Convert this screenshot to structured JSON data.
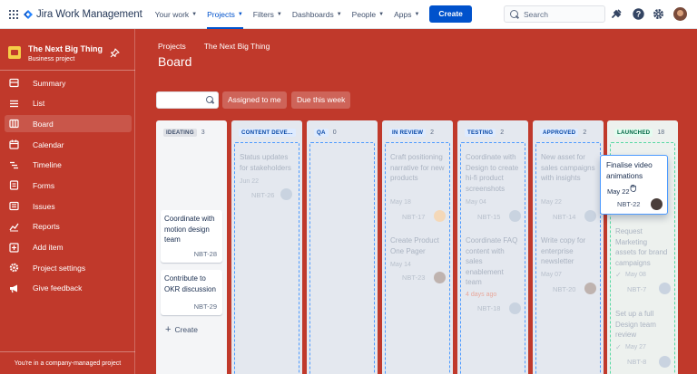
{
  "topnav": {
    "brand": "Jira Work Management",
    "menu": [
      {
        "label": "Your work"
      },
      {
        "label": "Projects"
      },
      {
        "label": "Filters"
      },
      {
        "label": "Dashboards"
      },
      {
        "label": "People"
      },
      {
        "label": "Apps"
      }
    ],
    "active_menu": "Projects",
    "create_label": "Create",
    "search_placeholder": "Search",
    "colors": {
      "accent": "#0052cc"
    }
  },
  "sidebar": {
    "project_name": "The Next Big Thing",
    "project_type": "Business project",
    "items": [
      {
        "label": "Summary",
        "icon": "summary-icon"
      },
      {
        "label": "List",
        "icon": "list-icon"
      },
      {
        "label": "Board",
        "icon": "board-icon",
        "active": true
      },
      {
        "label": "Calendar",
        "icon": "calendar-icon"
      },
      {
        "label": "Timeline",
        "icon": "timeline-icon"
      },
      {
        "label": "Forms",
        "icon": "forms-icon"
      },
      {
        "label": "Issues",
        "icon": "issues-icon"
      },
      {
        "label": "Reports",
        "icon": "reports-icon"
      },
      {
        "label": "Add item",
        "icon": "add-item-icon"
      },
      {
        "label": "Project settings",
        "icon": "gear-icon"
      },
      {
        "label": "Give feedback",
        "icon": "megaphone-icon"
      }
    ],
    "footer": "You're in a company-managed project"
  },
  "page": {
    "breadcrumb": [
      "Projects",
      "The Next Big Thing"
    ],
    "title": "Board",
    "filters": {
      "assigned": "Assigned to me",
      "due": "Due this week"
    },
    "background": "#c0392b"
  },
  "board": {
    "columns": [
      {
        "name": "IDEATING",
        "count": "3",
        "tag_bg": "#dfe1e6",
        "tag_fg": "#42526e",
        "cards": [
          {
            "title": "Coordinate with motion design team",
            "key": "NBT-28"
          },
          {
            "title": "Contribute to OKR discussion",
            "key": "NBT-29"
          }
        ],
        "create_label": "Create"
      },
      {
        "name": "CONTENT DEVE...",
        "count": "",
        "tag_bg": "#deebff",
        "tag_fg": "#0747a6",
        "cards": [
          {
            "title": "Status updates for stakeholders",
            "date": "Jun 22",
            "key": "NBT-26"
          }
        ]
      },
      {
        "name": "QA",
        "count": "0",
        "tag_bg": "#deebff",
        "tag_fg": "#0747a6",
        "cards": []
      },
      {
        "name": "IN REVIEW",
        "count": "2",
        "tag_bg": "#deebff",
        "tag_fg": "#0747a6",
        "cards": [
          {
            "title": "Craft positioning narrative for new products",
            "date": "May 18",
            "key": "NBT-17"
          },
          {
            "title": "Create Product One Pager",
            "date": "May 14",
            "key": "NBT-23"
          }
        ]
      },
      {
        "name": "TESTING",
        "count": "2",
        "tag_bg": "#deebff",
        "tag_fg": "#0747a6",
        "cards": [
          {
            "title": "Coordinate with Design to create hi-fi product screenshots",
            "date": "May 04",
            "key": "NBT-15"
          },
          {
            "title": "Coordinate FAQ content with sales enablement team",
            "date": "4 days ago",
            "key": "NBT-18",
            "overdue": true
          }
        ]
      },
      {
        "name": "APPROVED",
        "count": "2",
        "tag_bg": "#deebff",
        "tag_fg": "#0747a6",
        "cards": [
          {
            "title": "New asset for sales campaigns with insights",
            "date": "May 22",
            "key": "NBT-14"
          },
          {
            "title": "Write copy for enterprise newsletter",
            "date": "May 07",
            "key": "NBT-20"
          }
        ]
      },
      {
        "name": "LAUNCHED",
        "count": "18",
        "tag_bg": "#e3fcef",
        "tag_fg": "#006644",
        "cards": [
          {
            "title": "Request Marketing assets for brand campaigns",
            "date": "May 08",
            "key": "NBT-7"
          },
          {
            "title": "Set up a full Design team review",
            "date": "May 27",
            "key": "NBT-8"
          }
        ]
      }
    ],
    "dragging": {
      "title": "Finalise video animations",
      "date": "May 22",
      "key": "NBT-22"
    }
  }
}
